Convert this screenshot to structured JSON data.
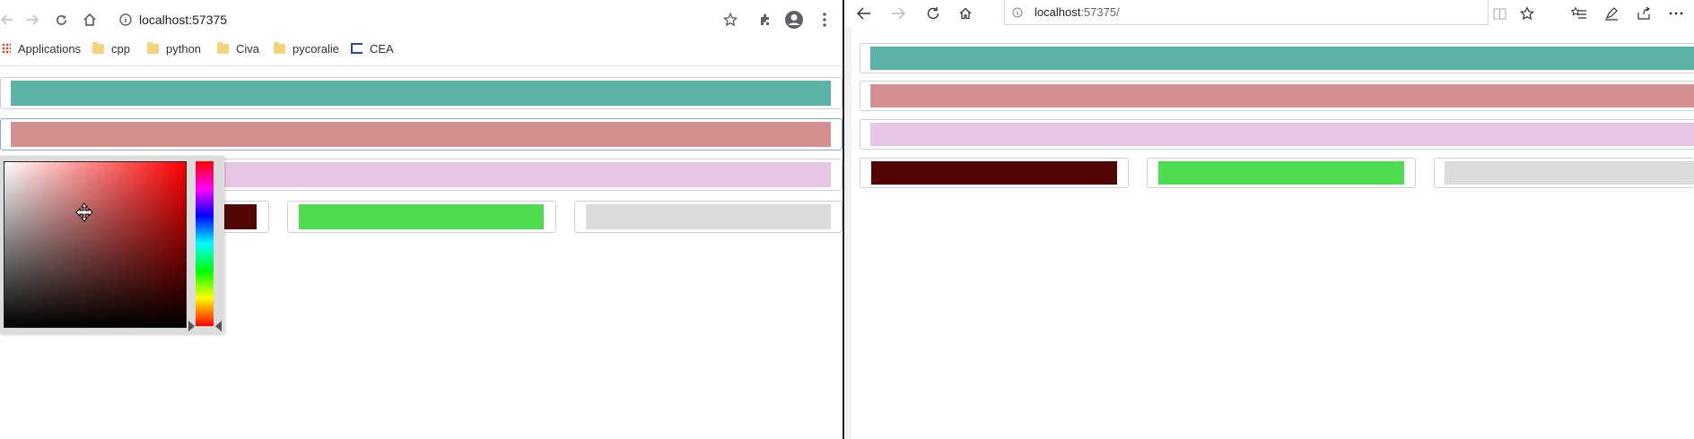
{
  "left_browser": {
    "url": "localhost:57375",
    "bookmarks": [
      {
        "label": "Applications",
        "icon": "apps-grid-icon"
      },
      {
        "label": "cpp",
        "icon": "folder-icon"
      },
      {
        "label": "python",
        "icon": "folder-icon"
      },
      {
        "label": "Civa",
        "icon": "folder-icon"
      },
      {
        "label": "pycoralie",
        "icon": "folder-icon"
      },
      {
        "label": "CEA",
        "icon": "bookmark-app-icon"
      }
    ],
    "color_fields": [
      {
        "color": "#5bb3a6"
      },
      {
        "color": "#d49090"
      },
      {
        "color": "#e6c6e4"
      },
      {
        "color": "#520505"
      },
      {
        "color": "#50dc50"
      },
      {
        "color": "#dcdcdc"
      }
    ],
    "picker": {
      "visible": true,
      "hue_color": "#ff0000"
    }
  },
  "right_browser": {
    "url_host": "localhost",
    "url_rest": ":57375/",
    "color_fields": [
      {
        "color": "#5bb3a6"
      },
      {
        "color": "#d49090"
      },
      {
        "color": "#e6c6e4"
      },
      {
        "color": "#520505"
      },
      {
        "color": "#50dc50"
      },
      {
        "color": "#dcdcdc"
      }
    ]
  }
}
